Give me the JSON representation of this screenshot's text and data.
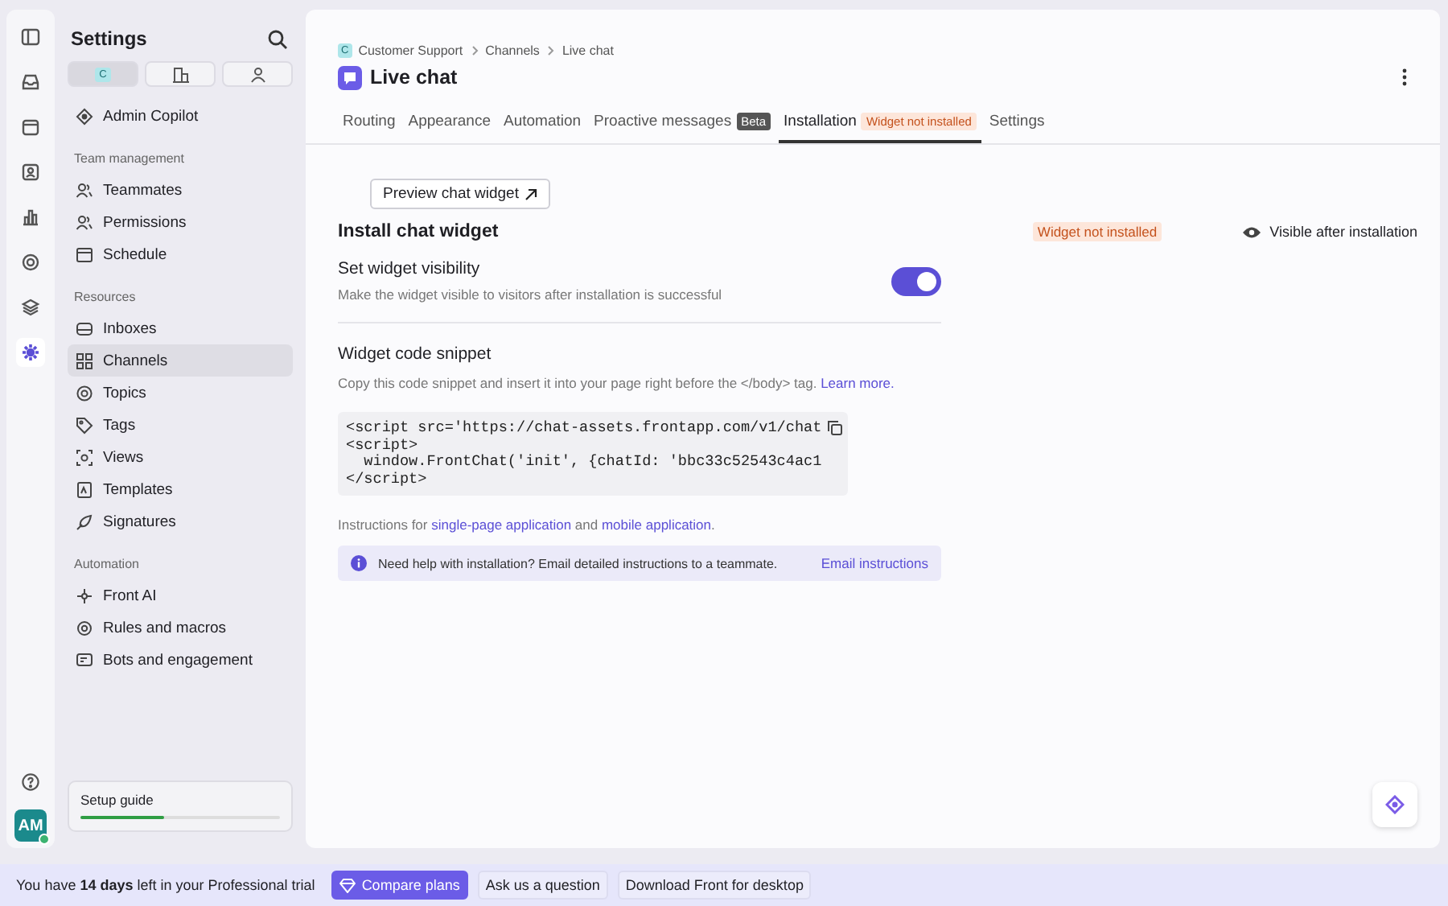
{
  "rail": [
    {
      "selected": false
    },
    {
      "selected": false
    },
    {
      "selected": false
    },
    {
      "selected": false
    },
    {
      "selected": false
    },
    {
      "selected": false
    },
    {
      "selected": false
    },
    {
      "selected": true
    }
  ],
  "user": {
    "initials": "AM",
    "online": true
  },
  "sidebar": {
    "title": "Settings",
    "scopes": [
      {
        "label": "C",
        "selected": true
      },
      {
        "selected": false
      },
      {
        "selected": false
      }
    ],
    "sections": [
      {
        "items": [
          {
            "label": "Admin Copilot",
            "selected": false
          }
        ]
      },
      {
        "heading": "Team management",
        "items": [
          {
            "label": "Teammates",
            "selected": false
          },
          {
            "label": "Permissions",
            "selected": false
          },
          {
            "label": "Schedule",
            "selected": false
          }
        ]
      },
      {
        "heading": "Resources",
        "items": [
          {
            "label": "Inboxes",
            "selected": false
          },
          {
            "label": "Channels",
            "selected": true
          },
          {
            "label": "Topics",
            "selected": false
          },
          {
            "label": "Tags",
            "selected": false
          },
          {
            "label": "Views",
            "selected": false
          },
          {
            "label": "Templates",
            "selected": false
          },
          {
            "label": "Signatures",
            "selected": false
          }
        ]
      },
      {
        "heading": "Automation",
        "items": [
          {
            "label": "Front AI",
            "selected": false
          },
          {
            "label": "Rules and macros",
            "selected": false
          },
          {
            "label": "Bots and engagement",
            "selected": false
          }
        ]
      }
    ],
    "setup_guide": {
      "label": "Setup guide",
      "level": 0.42
    }
  },
  "breadcrumb": {
    "badge": "C",
    "items": [
      "Customer Support",
      "Channels",
      "Live chat"
    ]
  },
  "page_title": "Live chat",
  "tabs": [
    {
      "label": "Routing",
      "selected": false
    },
    {
      "label": "Appearance",
      "selected": false
    },
    {
      "label": "Automation",
      "selected": false
    },
    {
      "label": "Proactive messages",
      "badge": "Beta",
      "kind": "dark",
      "selected": false
    },
    {
      "label": "Installation",
      "badge": "Widget not installed",
      "kind": "warning",
      "selected": true
    },
    {
      "label": "Settings",
      "selected": false
    }
  ],
  "preview_button": "Preview chat widget",
  "install": {
    "title": "Install chat widget",
    "status": "Widget not installed",
    "visibility": "Visible after installation"
  },
  "visibility_setting": {
    "title": "Set widget visibility",
    "description": "Make the widget visible to visitors after installation is successful",
    "on": true
  },
  "snippet": {
    "title": "Widget code snippet",
    "description": "Copy this code snippet and insert it into your page right before the </body> tag.",
    "link": "Learn more.",
    "code": [
      "<script src='https://chat-assets.frontapp.com/v1/chat",
      "<script>",
      "  window.FrontChat('init', {chatId: 'bbc33c52543c4ac1",
      "</script>"
    ]
  },
  "instructions": [
    {
      "text": "Instructions for"
    },
    {
      "link": "single-page application"
    },
    {
      "text": "and"
    },
    {
      "link": "mobile application"
    },
    {
      "text": "."
    }
  ],
  "help_banner": {
    "text": "Need help with installation? Email detailed instructions to a teammate.",
    "link": "Email instructions"
  },
  "trial_bar": {
    "message": "You have **14 days** left in your Professional trial",
    "buttons": [
      {
        "label": "Compare plans",
        "kind": "primary"
      },
      {
        "label": "Ask us a question",
        "kind": "secondary"
      },
      {
        "label": "Download Front for desktop",
        "kind": "secondary"
      }
    ]
  }
}
